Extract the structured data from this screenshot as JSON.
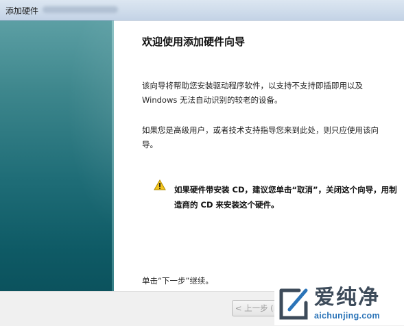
{
  "window": {
    "title": "添加硬件"
  },
  "page": {
    "heading": "欢迎使用添加硬件向导",
    "paragraph1": "该向导将帮助您安装驱动程序软件，以支持不支持即插即用以及 Windows 无法自动识别的较老的设备。",
    "paragraph2": "如果您是高级用户，或者技术支持指导您来到此处，则只应使用该向导。",
    "warning_icon": "warning-icon",
    "warning": "如果硬件带安装 CD，建议您单击“取消”，关闭这个向导，用制造商的 CD 来安装这个硬件。",
    "footer_note": "单击“下一步”继续。"
  },
  "buttons": {
    "back": "< 上一步 (B)"
  },
  "watermark": {
    "brand": "爱纯净",
    "url": "aichunjing.com"
  },
  "colors": {
    "sidebar_top": "#5c9fa4",
    "sidebar_bottom": "#0b4f5a",
    "warning_yellow": "#f4c51c",
    "watermark_url": "#2b74b8"
  }
}
